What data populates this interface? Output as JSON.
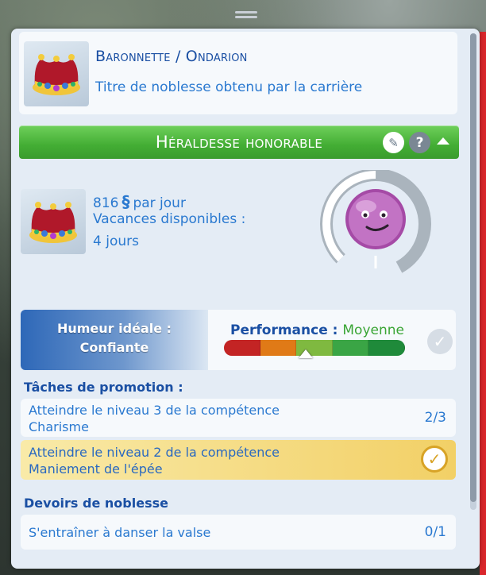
{
  "career": {
    "title": "Baronnette / Ondarion",
    "subtitle": "Titre de noblesse obtenu par la carrière",
    "level_title": "Héraldesse honorable",
    "bar_color": "#43ad34"
  },
  "info": {
    "salary_amount": "816",
    "currency_symbol": "§",
    "salary_unit": "par jour",
    "vacation_label": "Vacances disponibles  :",
    "vacation_value": "4 jours",
    "promotion_progress": 0.5
  },
  "mood": {
    "label": "Humeur idéale  :",
    "value": "Confiante"
  },
  "performance": {
    "label": "Performance  :",
    "value": "Moyenne",
    "level": 0.45,
    "segment_colors": [
      "#c32424",
      "#e07a17",
      "#7fb940",
      "#3aa545",
      "#1f8a3a"
    ]
  },
  "promotion_tasks": {
    "title": "Tâches de promotion  :",
    "items": [
      {
        "line1": "Atteindre le niveau 3  de la compétence",
        "line2": "Charisme",
        "count": "2/3",
        "done": false
      },
      {
        "line1": "Atteindre le niveau  2 de la compétence",
        "line2": "Maniement de l'épée",
        "count": "",
        "done": true
      }
    ]
  },
  "duties": {
    "title": "Devoirs de noblesse",
    "items": [
      {
        "line1": "S'entraîner à danser la valse",
        "count": "0/1"
      }
    ]
  },
  "icons": {
    "crown": "crown-icon",
    "edit": "pencil-icon",
    "help": "question-icon",
    "collapse": "chevron-up-icon",
    "check": "checkmark-icon",
    "mood": "confident-face-icon"
  }
}
